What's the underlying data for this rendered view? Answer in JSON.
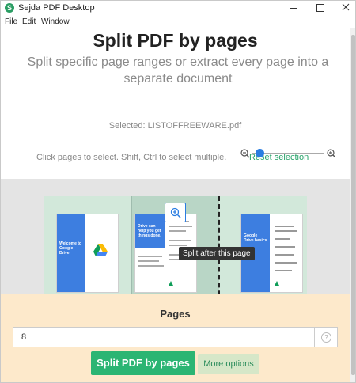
{
  "window": {
    "title": "Sejda PDF Desktop",
    "app_icon_letter": "S"
  },
  "menu": {
    "items": [
      "File",
      "Edit",
      "Window"
    ]
  },
  "header": {
    "title": "Split PDF by pages",
    "subtitle": "Split specific page ranges or extract every page into a separate document",
    "selected_file": "Selected: LISTOFFREEWARE.pdf",
    "hint": "Click pages to select. Shift, Ctrl to select multiple.",
    "reset_selection": "Reset selection"
  },
  "zoom": {
    "level": 0.1
  },
  "pages": [
    {
      "title": "Welcome to Google Drive"
    },
    {
      "title": "Drive can help you get things done."
    },
    {
      "title": "Google Drive basics"
    }
  ],
  "tooltip": "Split after this page",
  "bottom": {
    "pages_label": "Pages",
    "pages_value": "8",
    "help_icon": "?",
    "split_button": "Split PDF by pages",
    "more_options": "More options"
  },
  "colors": {
    "accent_green": "#2bb573",
    "link_green": "#29a36a",
    "blue": "#3d7ee0",
    "bottom_panel": "#fde9cb"
  }
}
